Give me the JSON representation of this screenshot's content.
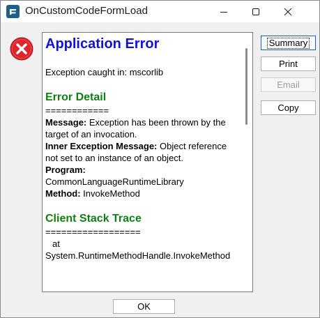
{
  "window": {
    "title": "OnCustomCodeFormLoad",
    "icon": "app-e-icon"
  },
  "report": {
    "title": "Application Error",
    "exception_caught": "Exception caught in: mscorlib",
    "error_detail_heading": "Error Detail",
    "error_detail_separator": "============",
    "message_label": "Message:",
    "message_value": " Exception has been thrown by the target of an invocation.",
    "inner_label": "Inner Exception Message:",
    "inner_value": " Object reference not set to an instance of an object.",
    "program_label": "Program:",
    "program_value": "CommonLanguageRuntimeLibrary",
    "method_label": "Method:",
    "method_value": " InvokeMethod",
    "stack_heading": "Client Stack Trace",
    "stack_separator": "==================",
    "stack_at": "at",
    "stack_method": "System.RuntimeMethodHandle.InvokeMethod"
  },
  "buttons": {
    "summary": "Summary",
    "print": "Print",
    "email": "Email",
    "copy": "Copy",
    "ok": "OK"
  },
  "colors": {
    "heading_blue": "#1010e0",
    "heading_green": "#108010",
    "error_red": "#e0242b"
  }
}
